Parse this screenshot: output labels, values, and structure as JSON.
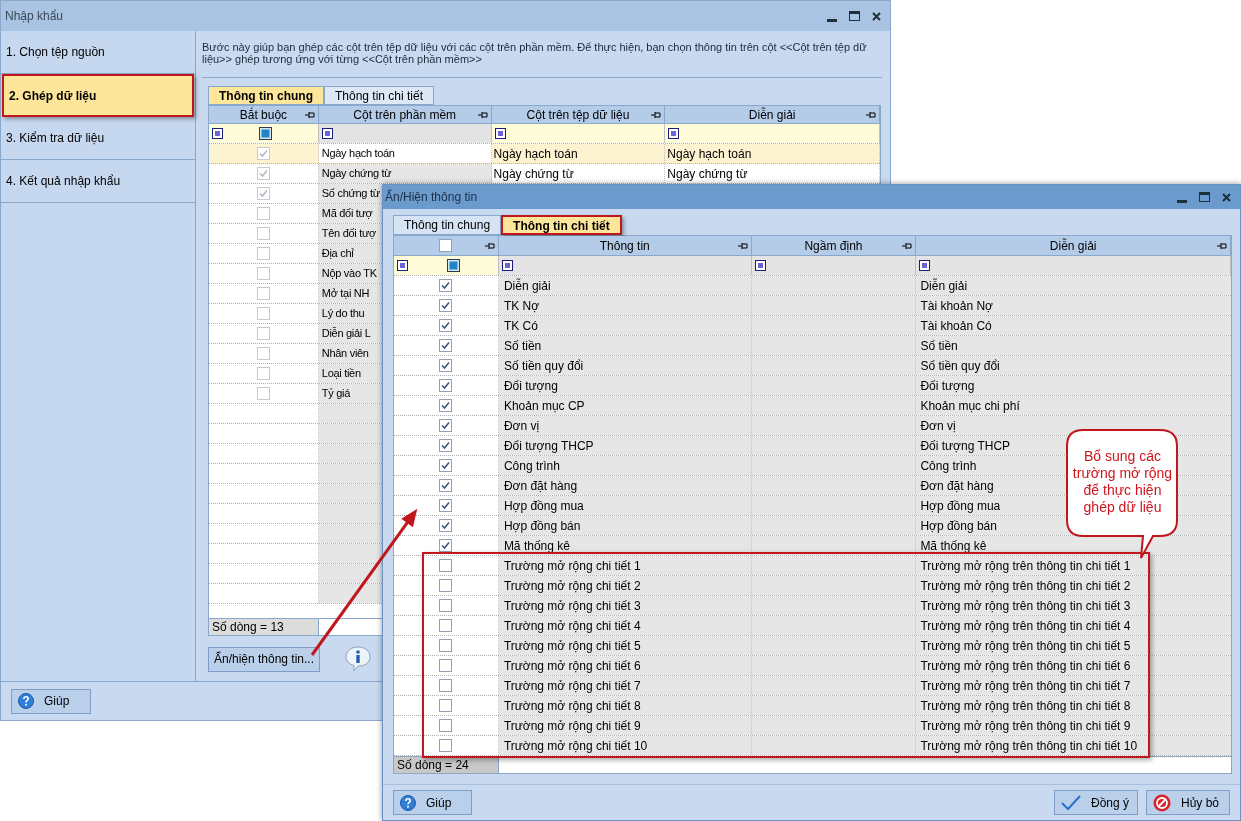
{
  "main_window": {
    "title": "Nhập khẩu",
    "steps": [
      {
        "label": "1. Chọn tệp nguồn",
        "selected": false
      },
      {
        "label": "2. Ghép dữ liệu",
        "selected": true
      },
      {
        "label": "3. Kiểm tra dữ liệu",
        "selected": false
      },
      {
        "label": "4. Kết quả nhập khẩu",
        "selected": false
      }
    ],
    "description": "Bước này giúp bạn ghép các cột trên tệp dữ liệu với các cột trên phần mềm. Để thực hiện, bạn chọn thông tin trên cột <<Cột trên tệp dữ liệu>> ghép tương ứng với từng <<Cột trên phần mềm>>",
    "tabs": [
      {
        "label": "Thông tin chung",
        "selected": true
      },
      {
        "label": "Thông tin chi tiết",
        "selected": false
      }
    ],
    "grid": {
      "columns": [
        "Bắt buộc",
        "Cột trên phần mềm",
        "Cột trên tệp dữ liệu",
        "Diễn giải"
      ],
      "rows": [
        {
          "checked": true,
          "selected": true,
          "cells": [
            "Ngày hạch toán",
            "Ngày hạch toán",
            "Ngày hạch toán"
          ]
        },
        {
          "checked": true,
          "selected": false,
          "cells": [
            "Ngày chứng từ",
            "Ngày chứng từ",
            "Ngày chứng từ"
          ]
        },
        {
          "checked": true,
          "selected": false,
          "cells": [
            "Số chứng từ"
          ]
        },
        {
          "checked": false,
          "selected": false,
          "cells": [
            "Mã đối tượ"
          ]
        },
        {
          "checked": false,
          "selected": false,
          "cells": [
            "Tên đối tượ"
          ]
        },
        {
          "checked": false,
          "selected": false,
          "cells": [
            "Địa chỉ"
          ]
        },
        {
          "checked": false,
          "selected": false,
          "cells": [
            "Nộp vào TK"
          ]
        },
        {
          "checked": false,
          "selected": false,
          "cells": [
            "Mở tại NH"
          ]
        },
        {
          "checked": false,
          "selected": false,
          "cells": [
            "Lý do thu"
          ]
        },
        {
          "checked": false,
          "selected": false,
          "cells": [
            "Diễn giải L"
          ]
        },
        {
          "checked": false,
          "selected": false,
          "cells": [
            "Nhân viên"
          ]
        },
        {
          "checked": false,
          "selected": false,
          "cells": [
            "Loại tiền"
          ]
        },
        {
          "checked": false,
          "selected": false,
          "cells": [
            "Tỷ giá"
          ]
        }
      ],
      "row_count": "Số dòng = 13"
    },
    "show_hide_button": "Ẩn/hiện thông tin...",
    "help_button": {
      "kind": "help",
      "label": "Giúp"
    }
  },
  "dialog": {
    "title": "Ẩn/Hiện thông tin",
    "tabs": [
      {
        "label": "Thông tin chung",
        "selected": false
      },
      {
        "label": "Thông tin chi tiết",
        "selected": true
      }
    ],
    "grid": {
      "select_all_checked": false,
      "columns": [
        "Thông tin",
        "Ngầm định",
        "Diễn giải"
      ],
      "rows": [
        {
          "checked": true,
          "info": "Diễn giải",
          "description": "Diễn giải"
        },
        {
          "checked": true,
          "info": "TK Nợ",
          "description": "Tài khoản Nợ"
        },
        {
          "checked": true,
          "info": "TK Có",
          "description": "Tài khoản Có"
        },
        {
          "checked": true,
          "info": "Số tiền",
          "description": "Số tiền"
        },
        {
          "checked": true,
          "info": "Số tiền quy đổi",
          "description": "Số tiền quy đổi"
        },
        {
          "checked": true,
          "info": "Đối tượng",
          "description": "Đối tượng"
        },
        {
          "checked": true,
          "info": "Khoản mục CP",
          "description": "Khoản mục chi phí"
        },
        {
          "checked": true,
          "info": "Đơn vị",
          "description": "Đơn vị"
        },
        {
          "checked": true,
          "info": "Đối tượng THCP",
          "description": "Đối tượng THCP"
        },
        {
          "checked": true,
          "info": "Công trình",
          "description": "Công trình"
        },
        {
          "checked": true,
          "info": "Đơn đặt hàng",
          "description": "Đơn đặt hàng"
        },
        {
          "checked": true,
          "info": "Hợp đồng mua",
          "description": "Hợp đồng mua"
        },
        {
          "checked": true,
          "info": "Hợp đồng bán",
          "description": "Hợp đồng bán"
        },
        {
          "checked": true,
          "info": "Mã thống kê",
          "description": "Mã thống kê"
        },
        {
          "checked": false,
          "info": "Trường mở rộng chi tiết 1",
          "description": "Trường mở rộng trên thông tin chi tiết 1"
        },
        {
          "checked": false,
          "info": "Trường mở rộng chi tiết 2",
          "description": "Trường mở rộng trên thông tin chi tiết 2"
        },
        {
          "checked": false,
          "info": "Trường mở rộng chi tiết 3",
          "description": "Trường mở rộng trên thông tin chi tiết 3"
        },
        {
          "checked": false,
          "info": "Trường mở rộng chi tiết 4",
          "description": "Trường mở rộng trên thông tin chi tiết 4"
        },
        {
          "checked": false,
          "info": "Trường mở rộng chi tiết 5",
          "description": "Trường mở rộng trên thông tin chi tiết 5"
        },
        {
          "checked": false,
          "info": "Trường mở rộng chi tiết 6",
          "description": "Trường mở rộng trên thông tin chi tiết 6"
        },
        {
          "checked": false,
          "info": "Trường mở rộng chi tiết 7",
          "description": "Trường mở rộng trên thông tin chi tiết 7"
        },
        {
          "checked": false,
          "info": "Trường mở rộng chi tiết 8",
          "description": "Trường mở rộng trên thông tin chi tiết 8"
        },
        {
          "checked": false,
          "info": "Trường mở rộng chi tiết 9",
          "description": "Trường mở rộng trên thông tin chi tiết 9"
        },
        {
          "checked": false,
          "info": "Trường mở rộng chi tiết 10",
          "description": "Trường mở rộng trên thông tin chi tiết 10"
        }
      ],
      "row_count": "Số dòng = 24"
    },
    "buttons": [
      {
        "kind": "help",
        "label": "Giúp"
      },
      {
        "kind": "ok",
        "label": "Đồng ý"
      },
      {
        "kind": "cancel",
        "label": "Hủy bỏ"
      }
    ]
  },
  "callout": {
    "text": "Bổ sung các trường mở rộng để thực hiện ghép dữ liệu"
  }
}
